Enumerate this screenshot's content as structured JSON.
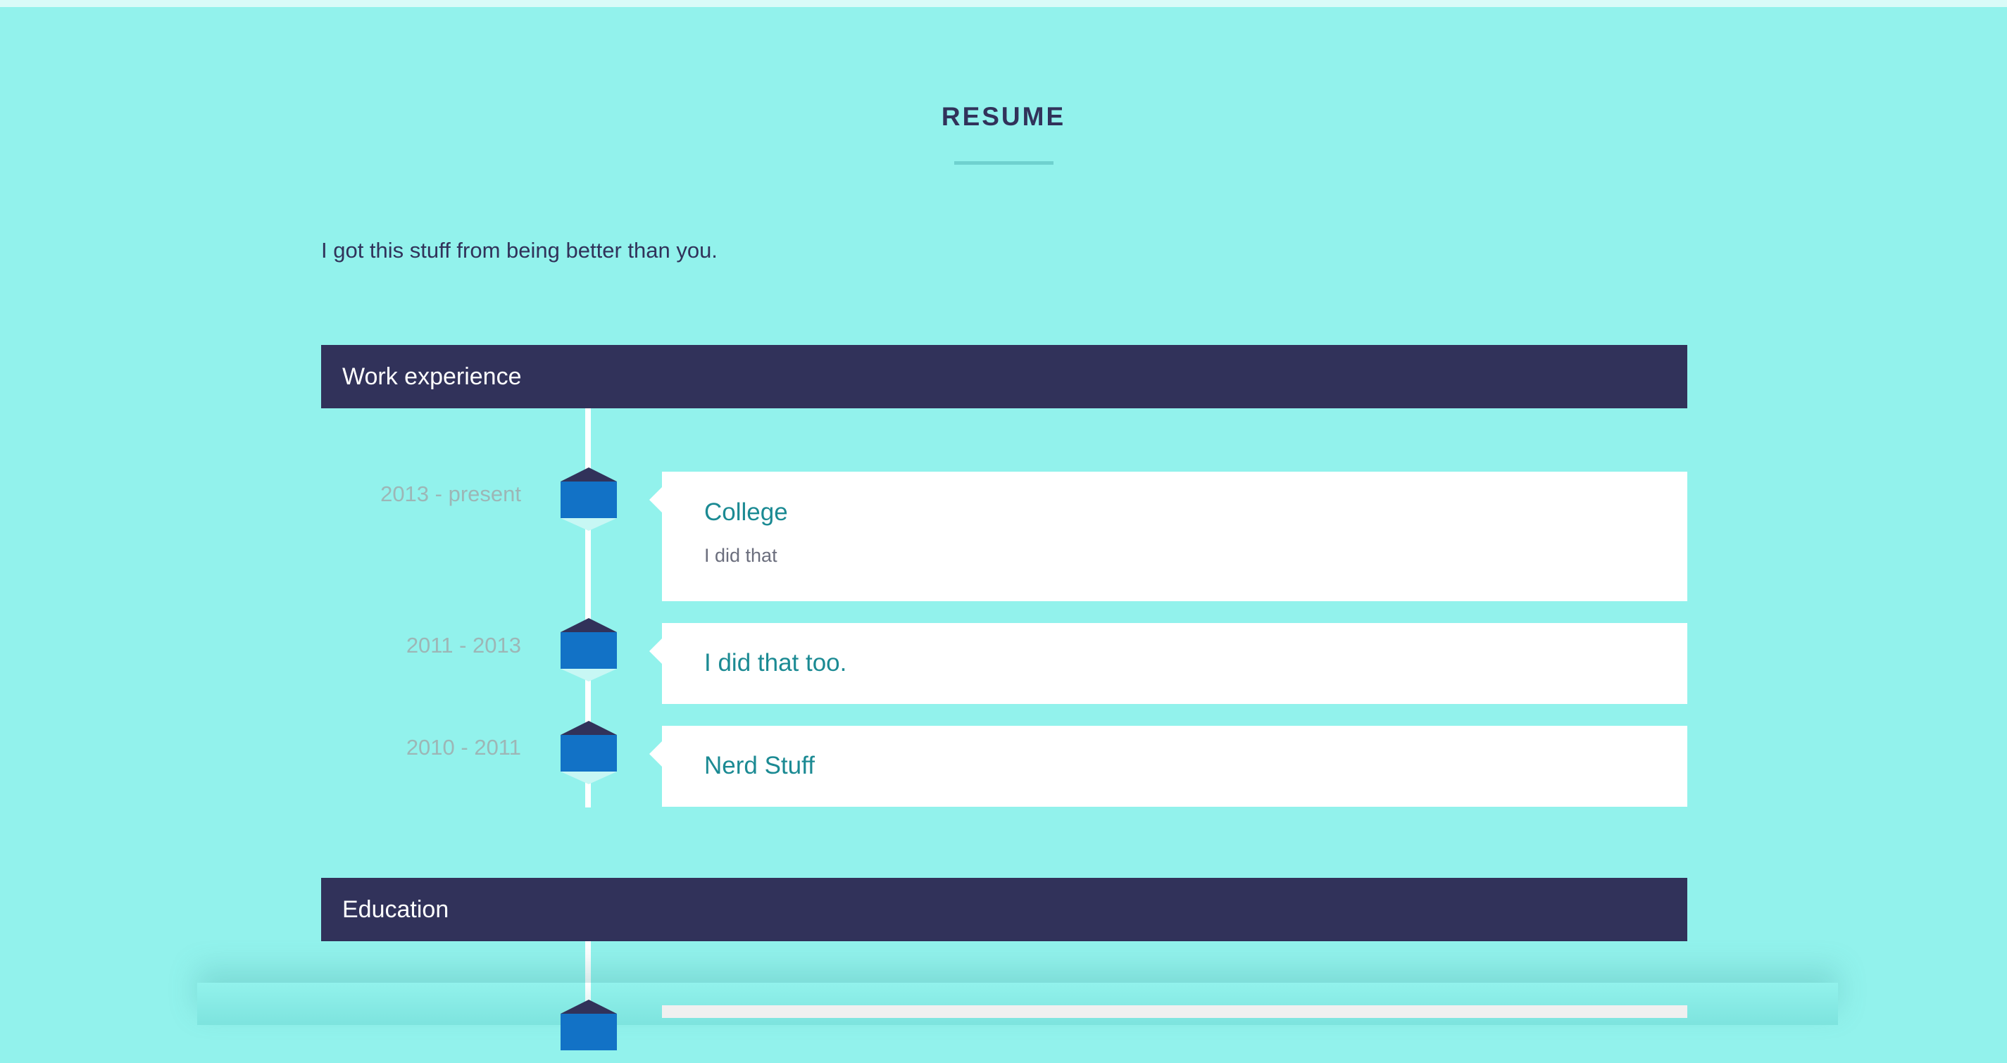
{
  "section": {
    "title": "RESUME",
    "intro": "I got this stuff from being better than you."
  },
  "work": {
    "heading": "Work experience",
    "entries": [
      {
        "dates": "2013 - present",
        "title": "College",
        "description": "I did that"
      },
      {
        "dates": "2011 - 2013",
        "title": "I did that too.",
        "description": ""
      },
      {
        "dates": "2010 - 2011",
        "title": "Nerd Stuff",
        "description": ""
      }
    ]
  },
  "education": {
    "heading": "Education"
  },
  "colors": {
    "background": "#92f2ec",
    "header": "#31325a",
    "accent": "#1b8a93",
    "marker": "#1272c6"
  }
}
